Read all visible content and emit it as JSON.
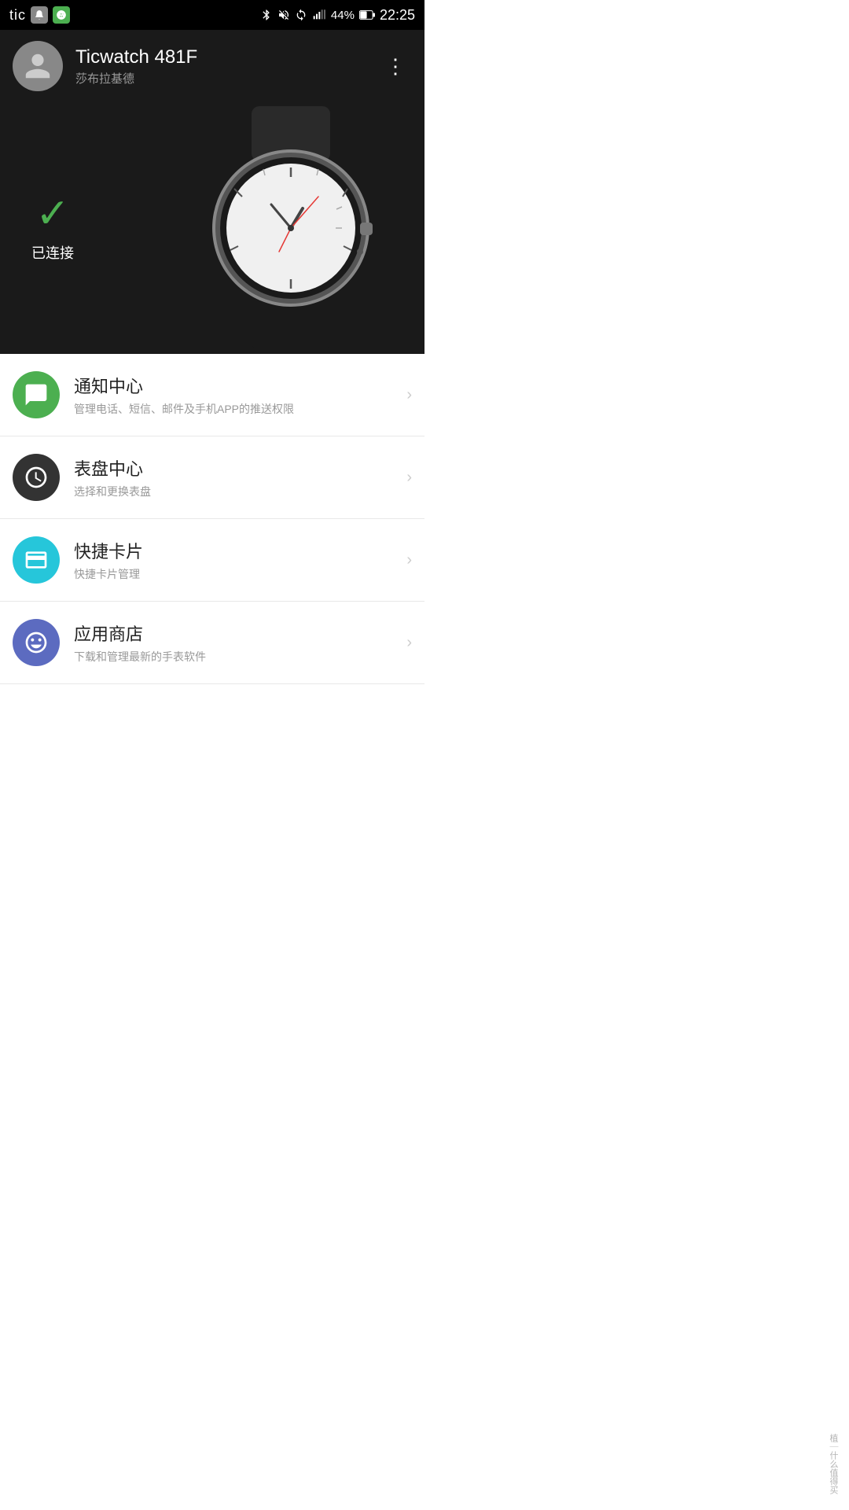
{
  "statusBar": {
    "appName": "tic",
    "bluetooth": "⬤",
    "battery": "44%",
    "time": "22:25"
  },
  "header": {
    "deviceName": "Ticwatch 481F",
    "subtitle": "莎布拉基德",
    "moreLabel": "⋮"
  },
  "hero": {
    "connectedCheck": "✓",
    "connectedText": "已连接"
  },
  "menuItems": [
    {
      "id": "notification",
      "iconColor": "green",
      "title": "通知中心",
      "subtitle": "管理电话、短信、邮件及手机APP的推送权限"
    },
    {
      "id": "watchface",
      "iconColor": "dark",
      "title": "表盘中心",
      "subtitle": "选择和更换表盘"
    },
    {
      "id": "quickcard",
      "iconColor": "teal",
      "title": "快捷卡片",
      "subtitle": "快捷卡片管理"
    },
    {
      "id": "appstore",
      "iconColor": "blue",
      "title": "应用商店",
      "subtitle": "下载和管理最新的手表软件"
    }
  ],
  "watermark": "植｜什么值得买"
}
